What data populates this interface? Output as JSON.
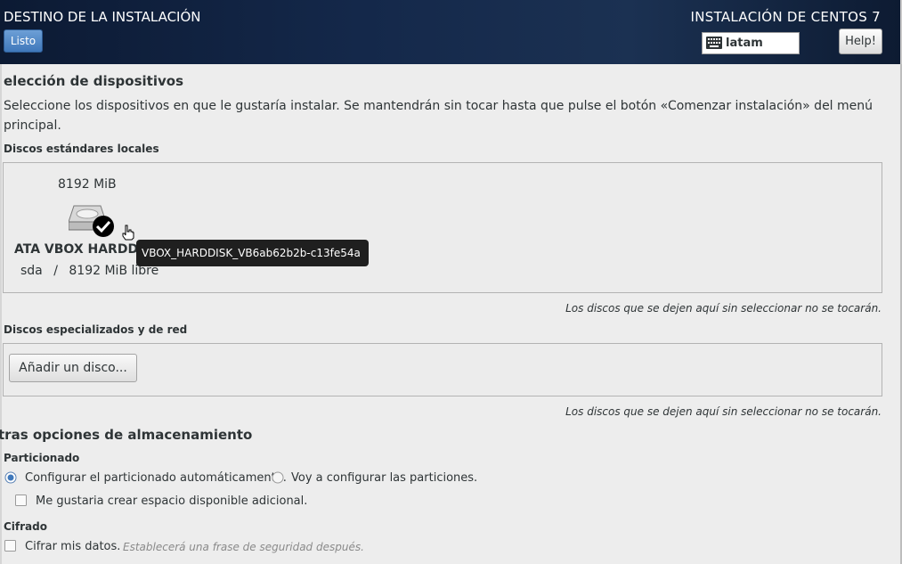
{
  "header": {
    "spoke_title": "DESTINO DE LA INSTALACIÓN",
    "done_label": "Listo",
    "product_title": "INSTALACIÓN DE CENTOS 7",
    "keyboard_layout": "latam",
    "help_label": "Help!"
  },
  "section_title": "elección de dispositivos",
  "intro_text": "Seleccione los dispositivos en que le gustaría instalar. Se mantendrán sin tocar hasta que pulse el botón «Comenzar instalación» del menú principal.",
  "local_disks": {
    "heading": "Discos estándares locales",
    "disk": {
      "size": "8192 MiB",
      "name": "ATA VBOX HARDD",
      "device": "sda",
      "separator": "/",
      "free": "8192 MiB libre",
      "tooltip": "VBOX_HARDDISK_VB6ab62b2b-c13fe54a",
      "selected": true
    },
    "note": "Los discos que se dejen aquí sin seleccionar no se tocarán."
  },
  "network_disks": {
    "heading": "Discos especializados y de red",
    "add_button": "Añadir un disco...",
    "note": "Los discos que se dejen aquí sin seleccionar no se tocarán."
  },
  "other_options": {
    "heading": "tras opciones de almacenamiento",
    "partitioning": {
      "heading": "Particionado",
      "auto": "Configurar el particionado automáticamente.",
      "manual": "Voy a configurar las particiones.",
      "extra_space": "Me gustaria crear espacio disponible adicional."
    },
    "encryption": {
      "heading": "Cifrado",
      "encrypt": "Cifrar mis datos.",
      "hint": "Establecerá una frase de seguridad después."
    }
  },
  "colors": {
    "accent": "#3f78bb",
    "header_bg": "#14284a"
  }
}
